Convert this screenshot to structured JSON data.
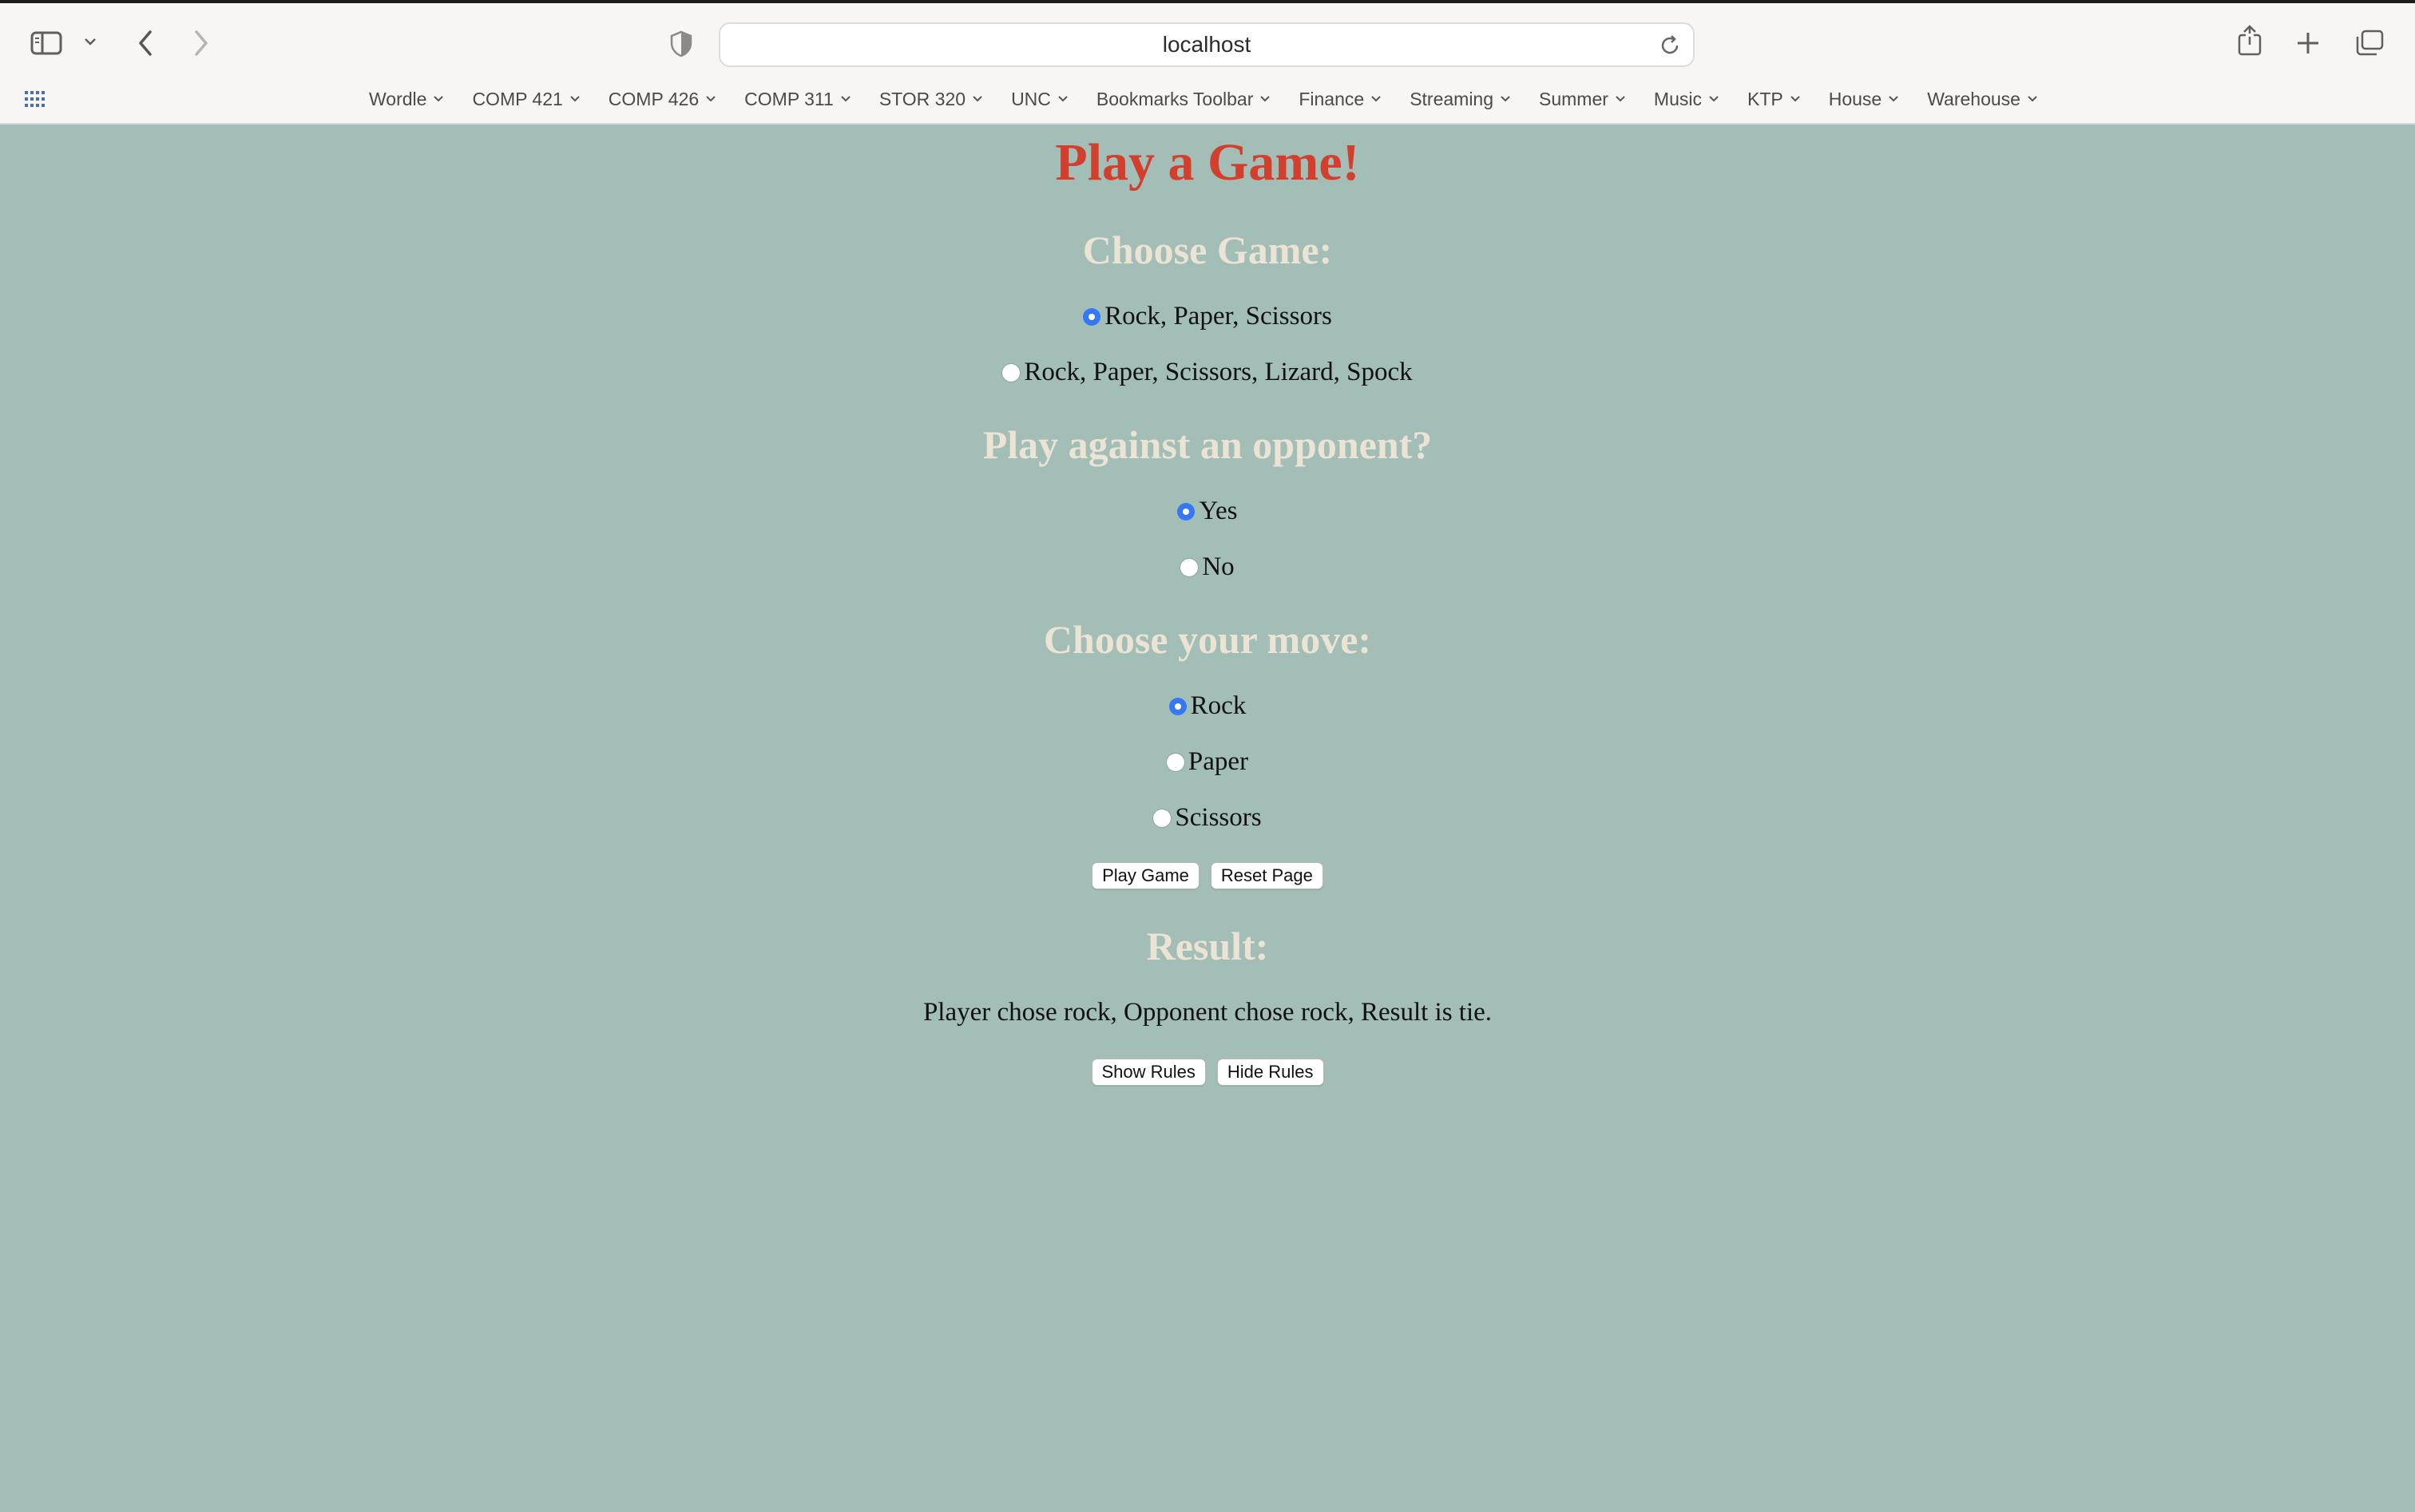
{
  "browser": {
    "url": "localhost",
    "bookmarks": [
      "Wordle",
      "COMP 421",
      "COMP 426",
      "COMP 311",
      "STOR 320",
      "UNC",
      "Bookmarks Toolbar",
      "Finance",
      "Streaming",
      "Summer",
      "Music",
      "KTP",
      "House",
      "Warehouse"
    ]
  },
  "page": {
    "title": "Play a Game!",
    "choose_game": {
      "heading": "Choose Game:",
      "options": [
        {
          "label": "Rock, Paper, Scissors",
          "checked": true
        },
        {
          "label": "Rock, Paper, Scissors, Lizard, Spock",
          "checked": false
        }
      ]
    },
    "opponent": {
      "heading": "Play against an opponent?",
      "options": [
        {
          "label": "Yes",
          "checked": true
        },
        {
          "label": "No",
          "checked": false
        }
      ]
    },
    "move": {
      "heading": "Choose your move:",
      "options": [
        {
          "label": "Rock",
          "checked": true
        },
        {
          "label": "Paper",
          "checked": false
        },
        {
          "label": "Scissors",
          "checked": false
        }
      ]
    },
    "buttons": {
      "play": "Play Game",
      "reset": "Reset Page"
    },
    "result": {
      "heading": "Result:",
      "text": "Player chose rock, Opponent chose rock, Result is tie."
    },
    "rules_buttons": {
      "show": "Show Rules",
      "hide": "Hide Rules"
    }
  },
  "colors": {
    "background": "#a3bdb7",
    "title": "#d2402d",
    "heading": "#ebe3d3",
    "radio_accent": "#3478f6"
  },
  "icons": [
    "sidebar-icon",
    "chevron-down-icon",
    "back-icon",
    "forward-icon",
    "privacy-shield-icon",
    "reload-icon",
    "share-icon",
    "new-tab-icon",
    "tab-overview-icon",
    "apps-grid-icon"
  ]
}
